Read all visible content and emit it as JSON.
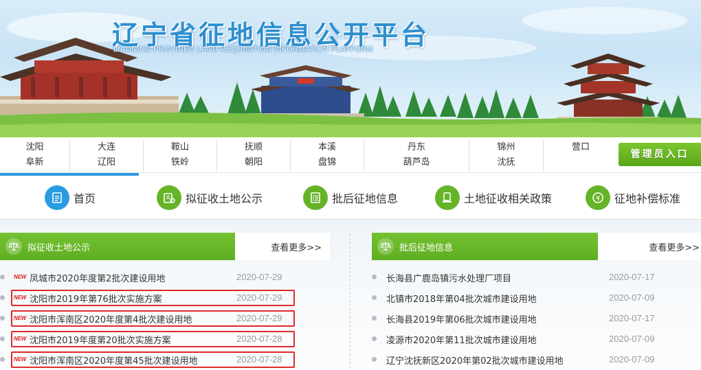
{
  "header": {
    "title": "辽宁省征地信息公开平台",
    "subtitle": "LIAONING PROVINEC LAND REQUISITION INFORMATION PLATFORM"
  },
  "cities": [
    [
      "沈阳",
      "阜新"
    ],
    [
      "大连",
      "辽阳"
    ],
    [
      "鞍山",
      "铁岭"
    ],
    [
      "抚顺",
      "朝阳"
    ],
    [
      "本溪",
      "盘锦"
    ],
    [
      "丹东",
      "葫芦岛"
    ],
    [
      "锦州",
      "沈抚"
    ],
    [
      "营口",
      ""
    ]
  ],
  "admin_button": "管理员入口",
  "nav": [
    {
      "label": "首页",
      "icon": "home-document-icon"
    },
    {
      "label": "拟征收土地公示",
      "icon": "announcement-icon"
    },
    {
      "label": "批后征地信息",
      "icon": "list-icon"
    },
    {
      "label": "土地征收相关政策",
      "icon": "policy-hand-icon"
    },
    {
      "label": "征地补偿标准",
      "icon": "yuan-coin-icon"
    }
  ],
  "left_panel": {
    "title": "拟征收土地公示",
    "more": "查看更多>>",
    "items": [
      {
        "title": "凤城市2020年度第2批次建设用地",
        "date": "2020-07-29",
        "tag": "NEW"
      },
      {
        "title": "沈阳市2019年第76批次实施方案",
        "date": "2020-07-29",
        "tag": "NEW"
      },
      {
        "title": "沈阳市浑南区2020年度第4批次建设用地",
        "date": "2020-07-29",
        "tag": "NEW"
      },
      {
        "title": "沈阳市2019年度第20批次实施方案",
        "date": "2020-07-28",
        "tag": "NEW"
      },
      {
        "title": "沈阳市浑南区2020年度第45批次建设用地",
        "date": "2020-07-28",
        "tag": "NEW"
      }
    ]
  },
  "right_panel": {
    "title": "批后征地信息",
    "more": "查看更多>>",
    "items": [
      {
        "title": "长海县广鹿岛镇污水处理厂项目",
        "date": "2020-07-17"
      },
      {
        "title": "北镇市2018年第04批次城市建设用地",
        "date": "2020-07-09"
      },
      {
        "title": "长海县2019年第06批次城市建设用地",
        "date": "2020-07-17"
      },
      {
        "title": "凌源市2020年第11批次城市建设用地",
        "date": "2020-07-09"
      },
      {
        "title": "辽宁沈抚新区2020年第02批次城市建设用地",
        "date": "2020-07-09"
      }
    ]
  },
  "colors": {
    "brand_blue": "#2a9be0",
    "brand_green": "#65b428",
    "highlight_red": "#e02a2a"
  }
}
